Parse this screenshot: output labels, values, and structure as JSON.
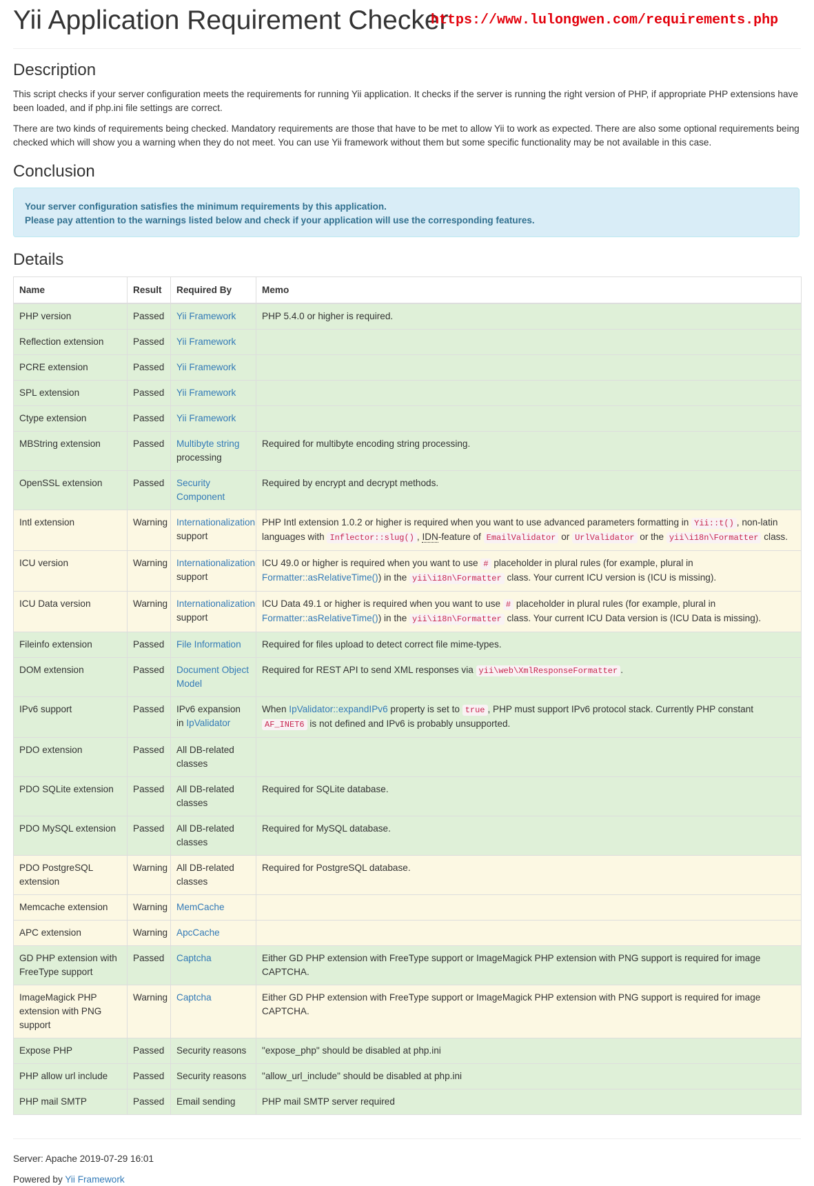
{
  "header": {
    "title": "Yii Application Requirement Checker",
    "url": "https://www.lulongwen.com/requirements.php"
  },
  "description": {
    "heading": "Description",
    "p1": "This script checks if your server configuration meets the requirements for running Yii application. It checks if the server is running the right version of PHP, if appropriate PHP extensions have been loaded, and if php.ini file settings are correct.",
    "p2": "There are two kinds of requirements being checked. Mandatory requirements are those that have to be met to allow Yii to work as expected. There are also some optional requirements being checked which will show you a warning when they do not meet. You can use Yii framework without them but some specific functionality may be not available in this case."
  },
  "conclusion": {
    "heading": "Conclusion",
    "line1": "Your server configuration satisfies the minimum requirements by this application.",
    "line2": "Please pay attention to the warnings listed below and check if your application will use the corresponding features."
  },
  "details": {
    "heading": "Details",
    "columns": [
      "Name",
      "Result",
      "Required By",
      "Memo"
    ],
    "rows": [
      {
        "name": "PHP version",
        "result": "Passed",
        "by": "Yii Framework",
        "by_link": true,
        "memo": "PHP 5.4.0 or higher is required."
      },
      {
        "name": "Reflection extension",
        "result": "Passed",
        "by": "Yii Framework",
        "by_link": true,
        "memo": ""
      },
      {
        "name": "PCRE extension",
        "result": "Passed",
        "by": "Yii Framework",
        "by_link": true,
        "memo": ""
      },
      {
        "name": "SPL extension",
        "result": "Passed",
        "by": "Yii Framework",
        "by_link": true,
        "memo": ""
      },
      {
        "name": "Ctype extension",
        "result": "Passed",
        "by": "Yii Framework",
        "by_link": true,
        "memo": ""
      },
      {
        "name": "MBString extension",
        "result": "Passed",
        "by": "Multibyte string",
        "by_link": true,
        "by_suffix": "processing",
        "memo": "Required for multibyte encoding string processing."
      },
      {
        "name": "OpenSSL extension",
        "result": "Passed",
        "by": "Security Component",
        "by_link": true,
        "memo": "Required by encrypt and decrypt methods."
      },
      {
        "name": "Intl extension",
        "result": "Warning",
        "by": "Internationalization",
        "by_link": true,
        "by_suffix": "support",
        "memo_parts": [
          {
            "t": "PHP Intl extension 1.0.2 or higher is required when you want to use advanced parameters formatting in "
          },
          {
            "t": "Yii::t()",
            "code": true
          },
          {
            "t": ", non-latin languages with "
          },
          {
            "t": "Inflector::slug()",
            "code": true
          },
          {
            "t": ", "
          },
          {
            "t": "IDN",
            "abbr": true
          },
          {
            "t": "-feature of "
          },
          {
            "t": "EmailValidator",
            "code": true
          },
          {
            "t": " or "
          },
          {
            "t": "UrlValidator",
            "code": true
          },
          {
            "t": " or the "
          },
          {
            "t": "yii\\i18n\\Formatter",
            "code": true
          },
          {
            "t": " class."
          }
        ]
      },
      {
        "name": "ICU version",
        "result": "Warning",
        "by": "Internationalization",
        "by_link": true,
        "by_suffix": "support",
        "memo_parts": [
          {
            "t": "ICU 49.0 or higher is required when you want to use "
          },
          {
            "t": "#",
            "code": true
          },
          {
            "t": " placeholder in plural rules (for example, plural in "
          },
          {
            "t": "Formatter::asRelativeTime()",
            "link": true
          },
          {
            "t": ") in the "
          },
          {
            "t": "yii\\i18n\\Formatter",
            "code": true
          },
          {
            "t": " class. Your current ICU version is (ICU is missing)."
          }
        ]
      },
      {
        "name": "ICU Data version",
        "result": "Warning",
        "by": "Internationalization",
        "by_link": true,
        "by_suffix": "support",
        "memo_parts": [
          {
            "t": "ICU Data 49.1 or higher is required when you want to use "
          },
          {
            "t": "#",
            "code": true
          },
          {
            "t": " placeholder in plural rules (for example, plural in "
          },
          {
            "t": "Formatter::asRelativeTime()",
            "link": true
          },
          {
            "t": ") in the "
          },
          {
            "t": "yii\\i18n\\Formatter",
            "code": true
          },
          {
            "t": " class. Your current ICU Data version is (ICU Data is missing)."
          }
        ]
      },
      {
        "name": "Fileinfo extension",
        "result": "Passed",
        "by": "File Information",
        "by_link": true,
        "memo": "Required for files upload to detect correct file mime-types."
      },
      {
        "name": "DOM extension",
        "result": "Passed",
        "by": "Document Object Model",
        "by_link": true,
        "memo_parts": [
          {
            "t": "Required for REST API to send XML responses via "
          },
          {
            "t": "yii\\web\\XmlResponseFormatter",
            "code": true
          },
          {
            "t": "."
          }
        ]
      },
      {
        "name": "IPv6 support",
        "result": "Passed",
        "by": "IPv6 expansion in ",
        "by_link": false,
        "by_link2": "IpValidator",
        "memo_parts": [
          {
            "t": "When "
          },
          {
            "t": "IpValidator::expandIPv6",
            "link": true
          },
          {
            "t": " property is set to "
          },
          {
            "t": "true",
            "code": true
          },
          {
            "t": ", PHP must support IPv6 protocol stack. Currently PHP constant "
          },
          {
            "t": "AF_INET6",
            "code": true
          },
          {
            "t": " is not defined and IPv6 is probably unsupported."
          }
        ]
      },
      {
        "name": "PDO extension",
        "result": "Passed",
        "by": "All DB-related classes",
        "by_link": false,
        "memo": ""
      },
      {
        "name": "PDO SQLite extension",
        "result": "Passed",
        "by": "All DB-related classes",
        "by_link": false,
        "memo": "Required for SQLite database."
      },
      {
        "name": "PDO MySQL extension",
        "result": "Passed",
        "by": "All DB-related classes",
        "by_link": false,
        "memo": "Required for MySQL database."
      },
      {
        "name": "PDO PostgreSQL extension",
        "result": "Warning",
        "by": "All DB-related classes",
        "by_link": false,
        "memo": "Required for PostgreSQL database."
      },
      {
        "name": "Memcache extension",
        "result": "Warning",
        "by": "MemCache",
        "by_link": true,
        "memo": ""
      },
      {
        "name": "APC extension",
        "result": "Warning",
        "by": "ApcCache",
        "by_link": true,
        "memo": ""
      },
      {
        "name": "GD PHP extension with FreeType support",
        "result": "Passed",
        "by": "Captcha",
        "by_link": true,
        "memo": "Either GD PHP extension with FreeType support or ImageMagick PHP extension with PNG support is required for image CAPTCHA."
      },
      {
        "name": "ImageMagick PHP extension with PNG support",
        "result": "Warning",
        "by": "Captcha",
        "by_link": true,
        "memo": "Either GD PHP extension with FreeType support or ImageMagick PHP extension with PNG support is required for image CAPTCHA."
      },
      {
        "name": "Expose PHP",
        "result": "Passed",
        "by": "Security reasons",
        "by_link": false,
        "memo": "\"expose_php\" should be disabled at php.ini"
      },
      {
        "name": "PHP allow url include",
        "result": "Passed",
        "by": "Security reasons",
        "by_link": false,
        "memo": "\"allow_url_include\" should be disabled at php.ini"
      },
      {
        "name": "PHP mail SMTP",
        "result": "Passed",
        "by": "Email sending",
        "by_link": false,
        "memo": "PHP mail SMTP server required"
      }
    ]
  },
  "footer": {
    "server": "Server: Apache 2019-07-29 16:01",
    "powered_prefix": "Powered by ",
    "powered_link": "Yii Framework"
  }
}
